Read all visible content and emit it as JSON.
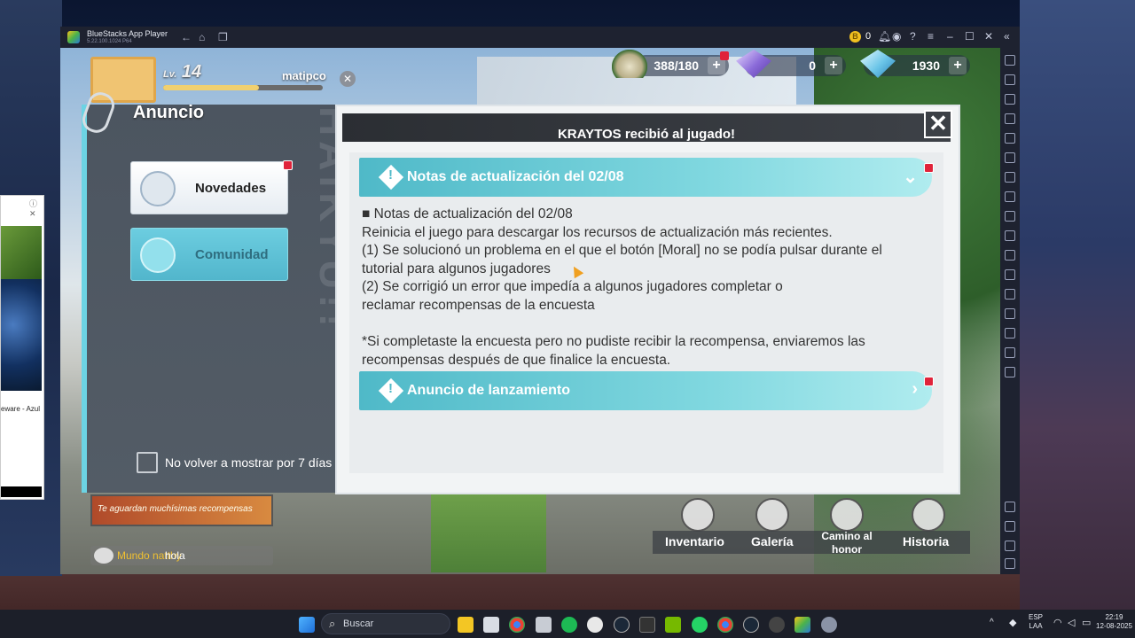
{
  "emulator": {
    "title": "BlueStacks App Player",
    "subtitle": "5.22.100.1024 P64",
    "coins": "0"
  },
  "hud": {
    "level_prefix": "Lv.",
    "level": "14",
    "player_name": "matipco",
    "resources": [
      {
        "icon": "rice-ball-icon",
        "value": "388/180"
      },
      {
        "icon": "purple-gem-icon",
        "value": "0"
      },
      {
        "icon": "blue-diamond-icon",
        "value": "1930"
      }
    ]
  },
  "notice": {
    "panel_title": "Anuncio",
    "header": "KRAYTOS recibió al jugado!",
    "tabs": [
      {
        "label": "Novedades",
        "selected": false
      },
      {
        "label": "Comunidad",
        "selected": true
      }
    ],
    "dont_show_label": "No volver a mostrar por 7 días",
    "watermark": "HAIKYU!!",
    "sections": [
      {
        "title": "Notas de actualización del 02/08",
        "expanded": true,
        "lines": [
          "■ Notas de actualización del 02/08",
          "Reinicia el juego para descargar los recursos de actualización más recientes.",
          "(1) Se solucionó un problema en el que el botón [Moral] no se podía pulsar durante el",
          "tutorial para algunos jugadores",
          "(2) Se corrigió un error que impedía a algunos jugadores completar o",
          "reclamar recompensas de la encuesta",
          "",
          "*Si completaste la encuesta pero no pudiste recibir la recompensa, enviaremos las",
          "recompensas después de que finalice la encuesta."
        ]
      },
      {
        "title": "Anuncio de lanzamiento",
        "expanded": false
      }
    ]
  },
  "bottom": {
    "banner": "Te aguardan muchísimas recompensas",
    "chat_name": "Mundo natthy",
    "chat_msg": "hola",
    "nav": [
      {
        "label": "Inventario"
      },
      {
        "label": "Galería"
      },
      {
        "label": "Camino al honor"
      },
      {
        "label": "Historia"
      }
    ]
  },
  "side_ad": {
    "caption": "eware - Azul"
  },
  "taskbar": {
    "search_placeholder": "Buscar",
    "lang": "ESP",
    "lang2": "LAA",
    "time": "22:19",
    "date": "12-08-2025"
  },
  "colors": {
    "accent_teal": "#4fb9c8",
    "badge_red": "#e0233a",
    "panel_dark": "#4c5560"
  }
}
